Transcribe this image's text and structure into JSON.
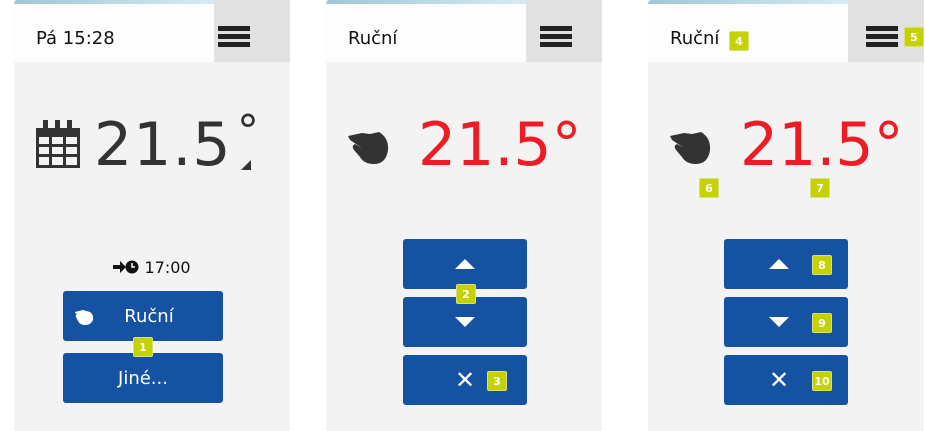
{
  "colors": {
    "accent_blue": "#1552a2",
    "temp_red": "#ee1c24",
    "badge": "#c6d100",
    "dark": "#333333"
  },
  "screen1": {
    "title": "Pá 15:28",
    "temperature": "21.5",
    "degree": "°",
    "schedule_time": "17:00",
    "manual_button_label": "Ruční",
    "other_button_label": "Jiné...",
    "badges": [
      "1"
    ]
  },
  "screen2": {
    "title": "Ruční",
    "temperature": "21.5°",
    "badges": [
      "2",
      "3"
    ]
  },
  "screen3": {
    "title": "Ruční",
    "temperature": "21.5°",
    "badges": [
      "4",
      "5",
      "6",
      "7",
      "8",
      "9",
      "10"
    ]
  },
  "icons": {
    "menu": "hamburger-icon",
    "calendar": "calendar-icon",
    "manual": "hand-icon",
    "schedule": "arrow-clock-icon",
    "up": "arrow-up-icon",
    "down": "arrow-down-icon",
    "cancel": "close-icon"
  }
}
